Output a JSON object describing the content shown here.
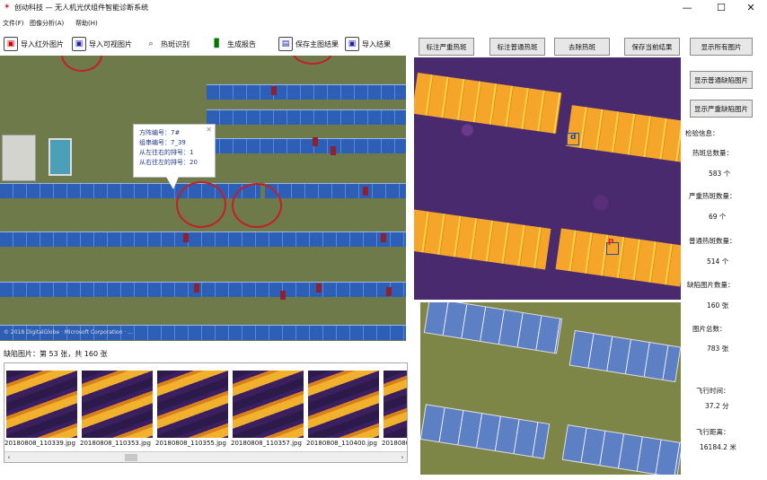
{
  "window": {
    "title": "创动科技 — 无人机光伏组件智能诊断系统",
    "minimize": "—",
    "maximize": "☐",
    "close": "✕"
  },
  "menu": [
    "文件(F)",
    "图像分析(A)",
    "帮助(H)"
  ],
  "toolbar": {
    "import_ir": "导入红外图片",
    "import_visible": "导入可视图片",
    "hotspot_detect": "热斑识别",
    "generate_report": "生成报告",
    "save_main": "保存主图结果",
    "import_result": "导入结果"
  },
  "map": {
    "popup": {
      "close": "✕",
      "lines": [
        "方阵编号：7#",
        "组串编号：7_39",
        "从左往右的排号：1",
        "从右往左的排号：20"
      ]
    },
    "attribution": "© 2018 DigitalGlobe  ·  Microsoft Corporation  ·  ..."
  },
  "fault_images_label": "缺陷图片：第 53 张，共 160 张",
  "thumbnails": [
    "20180808_110339.jpg",
    "20180808_110353.jpg",
    "20180808_110355.jpg",
    "20180808_110357.jpg",
    "20180808_110400.jpg",
    "20180808_"
  ],
  "right_buttons": {
    "mark_severe": "标注严重热斑",
    "mark_normal": "标注普通热斑",
    "remove_hotspot": "去除热斑",
    "save_current": "保存当前结果",
    "show_all": "显示所有图片",
    "show_normal_fault": "显示普通缺陷图片",
    "show_severe_fault": "显示严重缺陷图片"
  },
  "thermal_labels": [
    "d",
    "p"
  ],
  "stats": {
    "heading": "检验信息：",
    "items": [
      {
        "label": "热斑总数量：",
        "value": "583 个"
      },
      {
        "label": "严重热斑数量：",
        "value": "69 个"
      },
      {
        "label": "普通热斑数量：",
        "value": "514 个"
      },
      {
        "label": "缺陷图片数量：",
        "value": "160 张"
      },
      {
        "label": "图片总数：",
        "value": "783 张"
      },
      {
        "label": "飞行时间：",
        "value": "37.2 分"
      },
      {
        "label": "飞行距离：",
        "value": "16184.2 米"
      }
    ]
  },
  "colors": {
    "panel_blue": "#2d5fb6",
    "hotspot_circle": "#c1202a",
    "thermal_hot": "#f4a52a",
    "thermal_bg": "#4a2a6e"
  }
}
